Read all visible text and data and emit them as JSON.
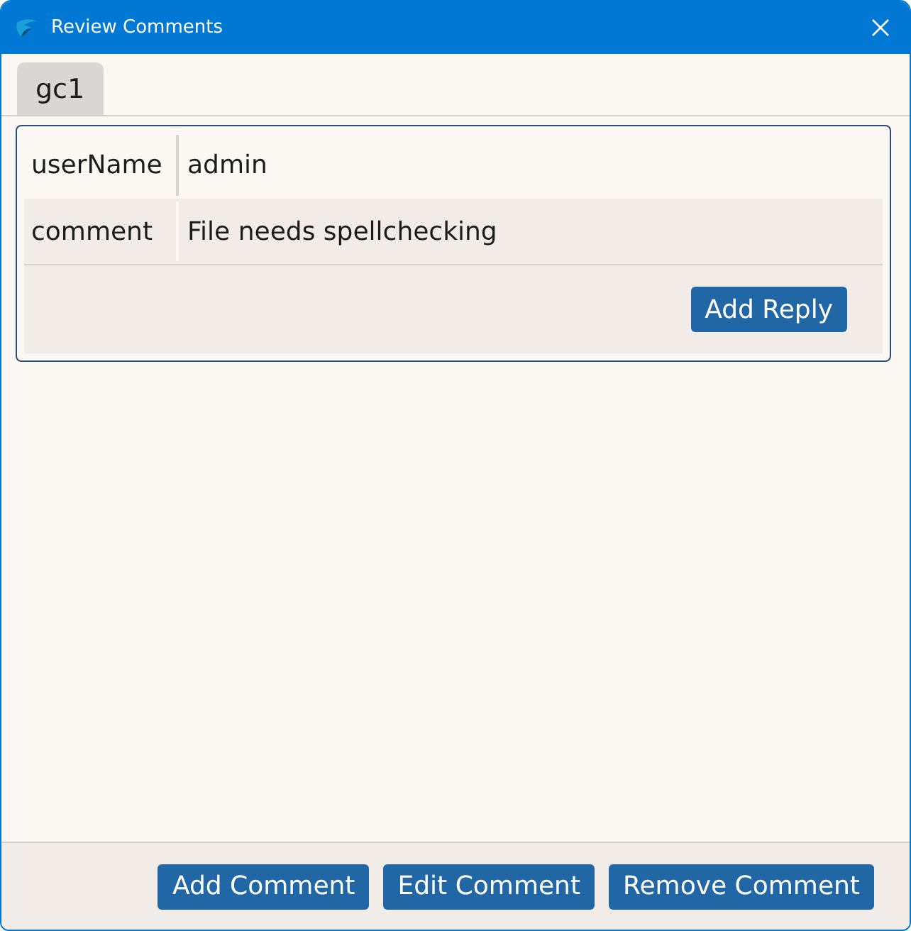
{
  "window": {
    "title": "Review Comments"
  },
  "tabs": [
    {
      "label": "gc1",
      "selected": true
    }
  ],
  "comment_panel": {
    "fields": [
      {
        "label": "userName",
        "value": "admin"
      },
      {
        "label": "comment",
        "value": "File needs spellchecking"
      }
    ],
    "reply_button": "Add Reply"
  },
  "footer_buttons": [
    "Add Comment",
    "Edit Comment",
    "Remove Comment"
  ]
}
